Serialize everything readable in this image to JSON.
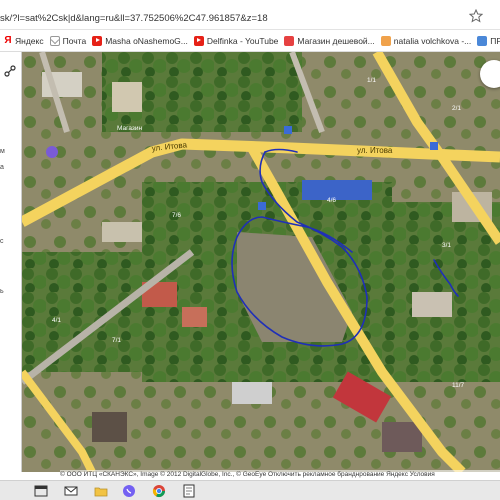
{
  "browser": {
    "url": "sk/?l=sat%2Csk|d&lang=ru&ll=37.752506%2C47.961857&z=18",
    "bookmarks": [
      {
        "label": "Яндекс",
        "icon": "yandex-icon"
      },
      {
        "label": "Почта",
        "icon": "mail-icon"
      },
      {
        "label": "Masha oNashemoG...",
        "icon": "youtube-icon"
      },
      {
        "label": "Delfinka - YouTube",
        "icon": "youtube-icon"
      },
      {
        "label": "Магазин дешевой...",
        "icon": "shop-icon"
      },
      {
        "label": "natalia volchkova -...",
        "icon": "ok-icon"
      },
      {
        "label": "ПРЕДПРИЯ...",
        "icon": "grid-icon"
      }
    ]
  },
  "sidebar": {
    "marks": [
      "м",
      "а",
      "с",
      "ь"
    ]
  },
  "map": {
    "street_left": "ул. Итова",
    "street_right": "ул. Итова",
    "shop_label": "Магазин",
    "labels": [
      "7/6",
      "4/6",
      "3/1",
      "2/1",
      "1/1",
      "11/7",
      "4/1",
      "7/1"
    ],
    "annotation_color": "#1f2fb8",
    "road_color": "#f4d35e",
    "attribution": "© ООО ИТЦ «СКАНЭКС», Image © 2012 DigitalGlobe, Inc., © GeoEye Отключить рекламное бранднрование  Яндекс  Условия"
  },
  "taskbar": {
    "icons": [
      "app-window-icon",
      "mail-icon",
      "folder-icon",
      "viber-icon",
      "chrome-icon",
      "notepad-icon"
    ]
  }
}
